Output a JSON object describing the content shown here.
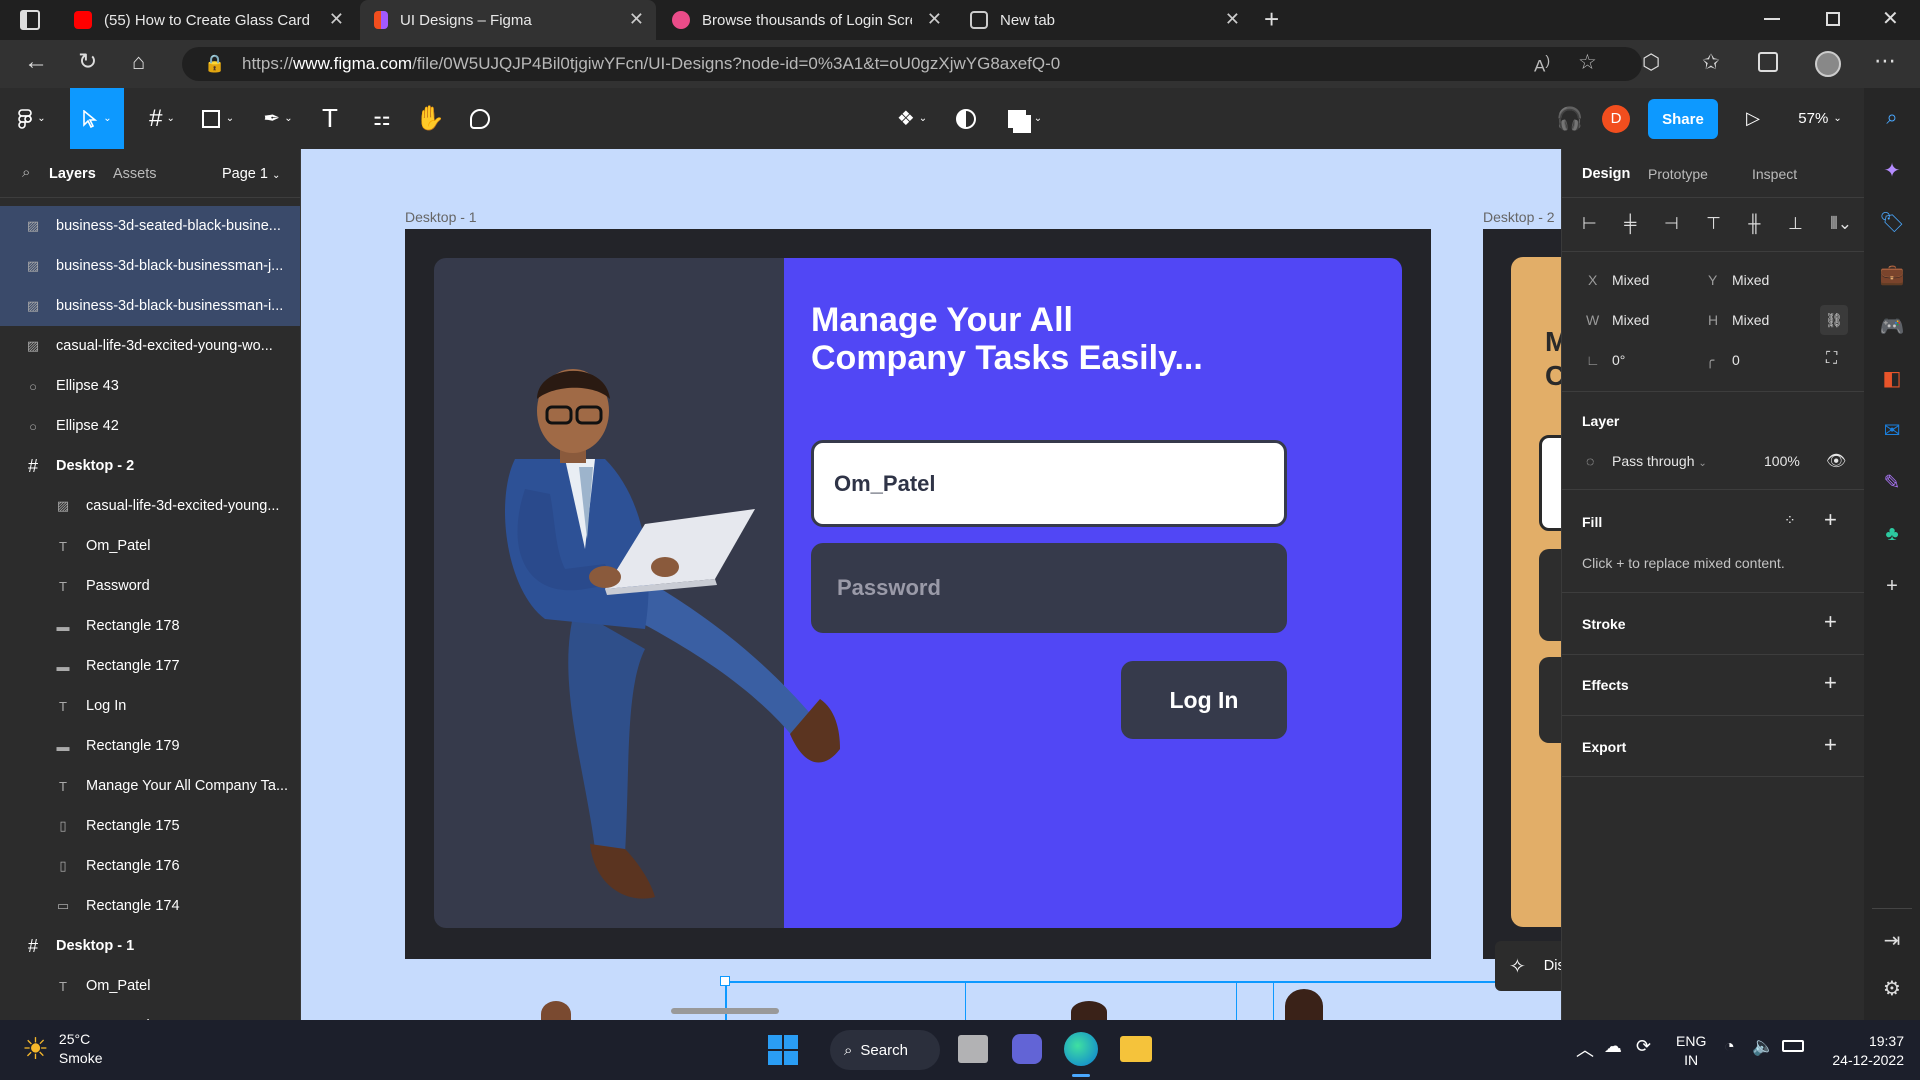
{
  "browser": {
    "tabs": [
      {
        "title": "(55) How to Create Glass Card Ef",
        "favicon": "youtube-icon",
        "active": false
      },
      {
        "title": "UI Designs – Figma",
        "favicon": "figma-icon",
        "active": true
      },
      {
        "title": "Browse thousands of Login Scree",
        "favicon": "dribbble-icon",
        "active": false
      },
      {
        "title": "New tab",
        "favicon": "newtab-icon",
        "active": false
      }
    ],
    "url_prefix": "https://",
    "url_host": "www.figma.com",
    "url_path": "/file/0W5UJQJP4Bil0tjgiwYFcn/UI-Designs?node-id=0%3A1&t=oU0gzXjwYG8axefQ-0"
  },
  "figma": {
    "avatar_letter": "D",
    "share_label": "Share",
    "zoom": "57%",
    "left_tabs": {
      "layers": "Layers",
      "assets": "Assets",
      "page": "Page 1"
    },
    "layers": [
      {
        "name": "business-3d-seated-black-busine...",
        "icon": "image",
        "indent": 0,
        "selected": true
      },
      {
        "name": "business-3d-black-businessman-j...",
        "icon": "image",
        "indent": 0,
        "selected": true
      },
      {
        "name": "business-3d-black-businessman-i...",
        "icon": "image",
        "indent": 0,
        "selected": true
      },
      {
        "name": "casual-life-3d-excited-young-wo...",
        "icon": "image",
        "indent": 0,
        "selected": false
      },
      {
        "name": "Ellipse 43",
        "icon": "ellipse",
        "indent": 0,
        "selected": false
      },
      {
        "name": "Ellipse 42",
        "icon": "ellipse",
        "indent": 0,
        "selected": false
      },
      {
        "name": "Desktop - 2",
        "icon": "frame",
        "indent": 0,
        "selected": false
      },
      {
        "name": "casual-life-3d-excited-young...",
        "icon": "image",
        "indent": 1,
        "selected": false
      },
      {
        "name": "Om_Patel",
        "icon": "text",
        "indent": 1,
        "selected": false
      },
      {
        "name": "Password",
        "icon": "text",
        "indent": 1,
        "selected": false
      },
      {
        "name": "Rectangle 178",
        "icon": "line",
        "indent": 1,
        "selected": false
      },
      {
        "name": "Rectangle 177",
        "icon": "line",
        "indent": 1,
        "selected": false
      },
      {
        "name": "Log In",
        "icon": "text",
        "indent": 1,
        "selected": false
      },
      {
        "name": "Rectangle 179",
        "icon": "line",
        "indent": 1,
        "selected": false
      },
      {
        "name": "Manage Your All Company Ta...",
        "icon": "text",
        "indent": 1,
        "selected": false
      },
      {
        "name": "Rectangle 175",
        "icon": "rect-tall",
        "indent": 1,
        "selected": false
      },
      {
        "name": "Rectangle 176",
        "icon": "rect-tall",
        "indent": 1,
        "selected": false
      },
      {
        "name": "Rectangle 174",
        "icon": "rect",
        "indent": 1,
        "selected": false
      },
      {
        "name": "Desktop - 1",
        "icon": "frame",
        "indent": 0,
        "selected": false
      },
      {
        "name": "Om_Patel",
        "icon": "text",
        "indent": 1,
        "selected": false
      },
      {
        "name": "Password",
        "icon": "text",
        "indent": 1,
        "selected": false
      }
    ],
    "canvas": {
      "frame1_label": "Desktop - 1",
      "frame2_label": "Desktop - 2",
      "heading_line1": "Manage Your All",
      "heading_line2": "Company Tasks Easily...",
      "username_value": "Om_Patel",
      "password_placeholder": "Password",
      "login_label": "Log In",
      "frame2_partial": "M\nC",
      "discover_label": "Discover more features",
      "help_label": "?"
    },
    "right": {
      "tabs": {
        "design": "Design",
        "prototype": "Prototype",
        "inspect": "Inspect"
      },
      "x_label": "X",
      "x_value": "Mixed",
      "y_label": "Y",
      "y_value": "Mixed",
      "w_label": "W",
      "w_value": "Mixed",
      "h_label": "H",
      "h_value": "Mixed",
      "rotation": "0°",
      "radius": "0",
      "layer_title": "Layer",
      "blend": "Pass through",
      "opacity": "100%",
      "fill_title": "Fill",
      "fill_note": "Click + to replace mixed content.",
      "stroke_title": "Stroke",
      "effects_title": "Effects",
      "export_title": "Export"
    }
  },
  "taskbar": {
    "temp": "25°C",
    "weather": "Smoke",
    "search": "Search",
    "lang1": "ENG",
    "lang2": "IN",
    "time": "19:37",
    "date": "24-12-2022"
  },
  "colors": {
    "accent": "#0d99ff",
    "card_purple": "#5147f5",
    "card_dark": "#363a4b",
    "frame_bg": "#232429",
    "canvas_bg": "#c6dbfd",
    "avatar": "#f24e1e",
    "frame2_card": "#e2ae68"
  }
}
